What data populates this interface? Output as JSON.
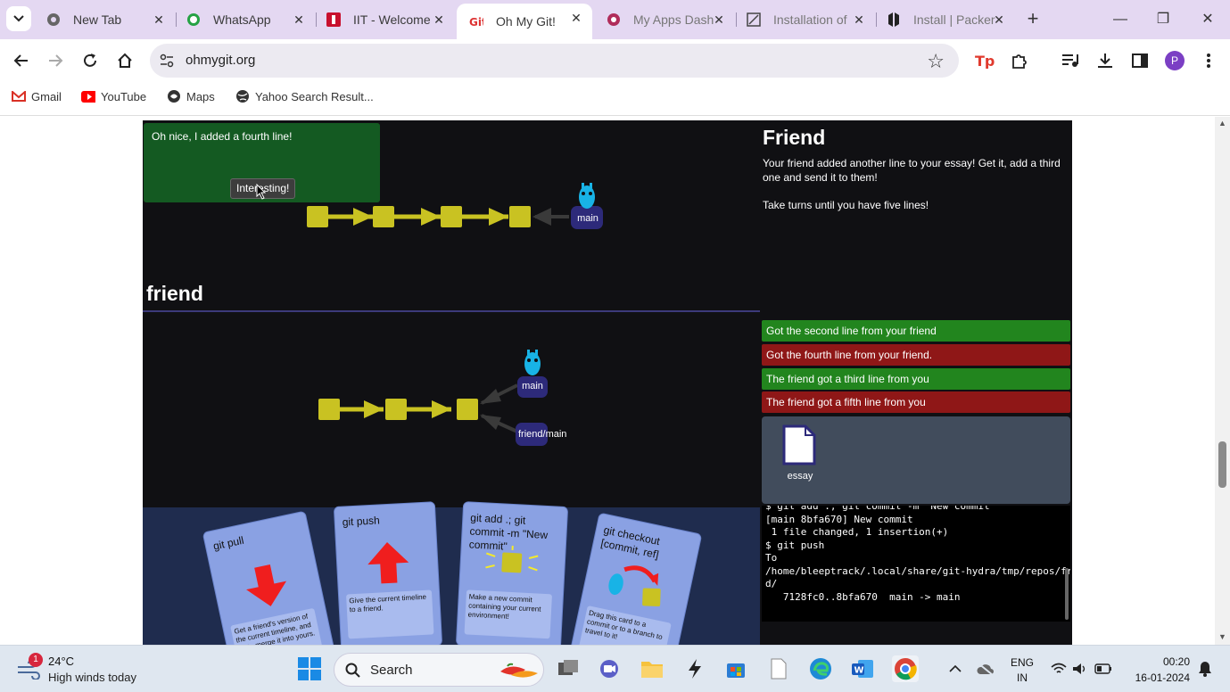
{
  "browser": {
    "tabs": [
      {
        "title": "New Tab",
        "icon": "chrome-icon"
      },
      {
        "title": "WhatsApp",
        "icon": "whatsapp-icon"
      },
      {
        "title": "IIT - Welcome",
        "icon": "iit-icon"
      },
      {
        "title": "Oh My Git!",
        "icon": "ohmygit-icon",
        "active": true
      },
      {
        "title": "My Apps Dash",
        "icon": "apps-icon"
      },
      {
        "title": "Installation of",
        "icon": "document-icon"
      },
      {
        "title": "Install | Packer",
        "icon": "hashicorp-icon"
      }
    ],
    "url": "ohmygit.org",
    "profile_initial": "P",
    "bookmarks": [
      {
        "label": "Gmail",
        "icon": "gmail-icon"
      },
      {
        "label": "YouTube",
        "icon": "youtube-icon"
      },
      {
        "label": "Maps",
        "icon": "maps-icon"
      },
      {
        "label": "Yahoo Search Result...",
        "icon": "globe-icon"
      }
    ]
  },
  "game": {
    "dialog": {
      "message": "Oh nice, I added a fourth line!",
      "button": "Interesting!"
    },
    "top_branch_label": "main",
    "section_title": "friend",
    "friend_branch_labels": {
      "main": "main",
      "remote": "friend/main"
    },
    "level": {
      "title": "Friend",
      "description": [
        "Your friend added another line to your essay! Get it, add a third one and send it to them!",
        "Take turns until you have five lines!"
      ]
    },
    "goals": [
      {
        "text": "Got the second line from your friend",
        "status": "done"
      },
      {
        "text": "Got the fourth line from your friend.",
        "status": "pending"
      },
      {
        "text": "The friend got a third line from you",
        "status": "done"
      },
      {
        "text": "The friend got a fifth line from you",
        "status": "pending"
      }
    ],
    "file_label": "essay",
    "terminal_lines": [
      "$ git add .; git commit -m \"New commit\"",
      "[main 8bfa670] New commit",
      " 1 file changed, 1 insertion(+)",
      "$ git push",
      "To",
      "/home/bleeptrack/.local/share/git-hydra/tmp/repos/frien",
      "d/",
      "   7128fc0..8bfa670  main -> main"
    ],
    "cards": [
      {
        "title": "git pull",
        "desc": "Get a friend's version of the current timeline, and try to merge it into yours."
      },
      {
        "title": "git push",
        "desc": "Give the current timeline to a friend."
      },
      {
        "title": "git add .; git commit -m \"New commit\"",
        "desc": "Make a new commit containing your current environment!"
      },
      {
        "title": "git checkout [commit, ref]",
        "desc": "Drag this card to a commit or to a branch to travel to it!"
      }
    ]
  },
  "taskbar": {
    "notification_count": "1",
    "temperature": "24°C",
    "weather": "High winds today",
    "search_label": "Search",
    "language": [
      "ENG",
      "IN"
    ],
    "time": "00:20",
    "date": "16-01-2024"
  },
  "colors": {
    "commit": "#c9c222",
    "goal_done": "#22851e",
    "goal_pending": "#8f1717",
    "branch_label_bg": "#2d2a7a",
    "card": "#8aa1e3"
  }
}
